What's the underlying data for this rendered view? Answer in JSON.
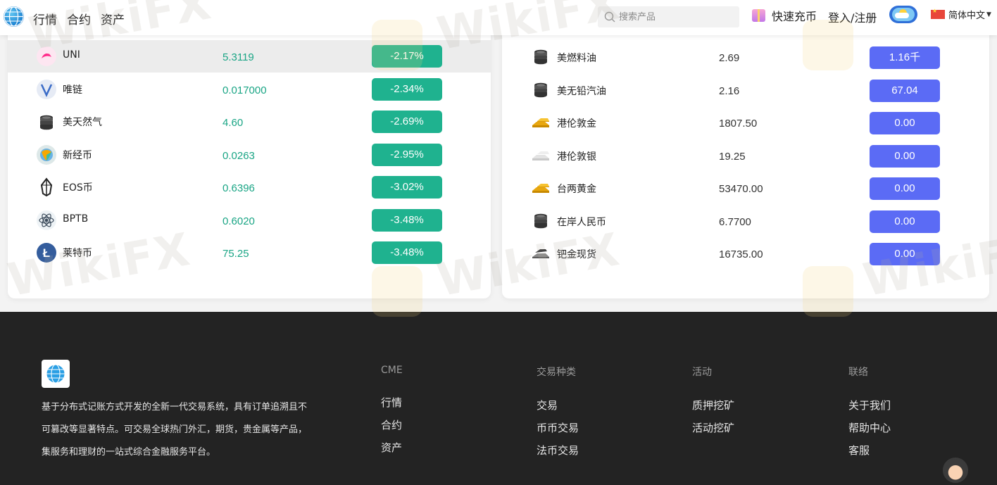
{
  "header": {
    "nav": [
      "行情",
      "合约",
      "资产"
    ],
    "search_placeholder": "搜索产品",
    "quick_buy": "快速充币",
    "login": "登入/注册",
    "language": "简体中文"
  },
  "left_panel": {
    "rows": [
      {
        "name": "UNI",
        "price": "5.3119",
        "change": "-2.17%",
        "icon": "uni-icon"
      },
      {
        "name": "唯链",
        "price": "0.017000",
        "change": "-2.34%",
        "icon": "vechain-icon"
      },
      {
        "name": "美天然气",
        "price": "4.60",
        "change": "-2.69%",
        "icon": "coin-stack-icon"
      },
      {
        "name": "新经币",
        "price": "0.0263",
        "change": "-2.95%",
        "icon": "nem-icon"
      },
      {
        "name": "EOS币",
        "price": "0.6396",
        "change": "-3.02%",
        "icon": "eos-icon"
      },
      {
        "name": "BPTB",
        "price": "0.6020",
        "change": "-3.48%",
        "icon": "bptb-icon"
      },
      {
        "name": "莱特币",
        "price": "75.25",
        "change": "-3.48%",
        "icon": "litecoin-icon"
      }
    ]
  },
  "right_panel": {
    "rows": [
      {
        "name": "美燃料油",
        "price": "2.69",
        "change": "1.16千",
        "icon": "coin-stack-icon"
      },
      {
        "name": "美无铅汽油",
        "price": "2.16",
        "change": "67.04",
        "icon": "coin-stack-icon"
      },
      {
        "name": "港伦敦金",
        "price": "1807.50",
        "change": "0.00",
        "icon": "gold-bar-icon"
      },
      {
        "name": "港伦敦银",
        "price": "19.25",
        "change": "0.00",
        "icon": "silver-bar-icon"
      },
      {
        "name": "台两黄金",
        "price": "53470.00",
        "change": "0.00",
        "icon": "gold-bar-icon"
      },
      {
        "name": "在岸人民币",
        "price": "6.7700",
        "change": "0.00",
        "icon": "coin-stack-icon"
      },
      {
        "name": "钯金现货",
        "price": "16735.00",
        "change": "0.00",
        "icon": "palladium-bar-icon"
      }
    ]
  },
  "footer": {
    "description_lines": [
      "基于分布式记账方式开发的全新一代交易系统，具有订单追溯且不",
      "可篡改等显著特点。可交易全球热门外汇，期货，贵金属等产品，",
      "集服务和理财的一站式综合金融服务平台。"
    ],
    "columns": [
      {
        "title": "CME",
        "links": [
          "行情",
          "合约",
          "资产"
        ]
      },
      {
        "title": "交易种类",
        "links": [
          "交易",
          "币币交易",
          "法币交易"
        ]
      },
      {
        "title": "活动",
        "links": [
          "质押挖矿",
          "活动挖矿"
        ]
      },
      {
        "title": "联络",
        "links": [
          "关于我们",
          "帮助中心",
          "客服"
        ]
      }
    ]
  },
  "watermark": "WikiFX",
  "colors": {
    "negative_change": "#1fb28f",
    "neutral_change": "#5b6bf5",
    "footer_bg": "#232323"
  }
}
